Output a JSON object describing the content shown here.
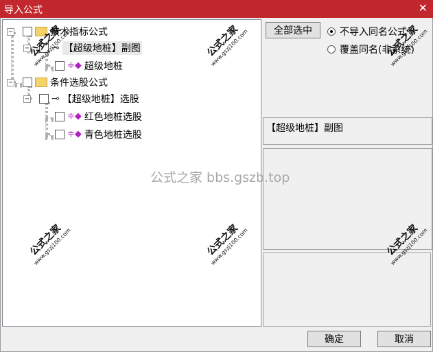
{
  "window": {
    "title": "导入公式",
    "close_glyph": "✕"
  },
  "tree": {
    "nodes": [
      {
        "id": "tech",
        "label": "技术指标公式",
        "kind": "folder"
      },
      {
        "id": "tech_sub",
        "label": "【超级地桩】副图",
        "kind": "key"
      },
      {
        "id": "tech_leaf",
        "label": "超级地桩",
        "kind": "formula"
      },
      {
        "id": "cond",
        "label": "条件选股公式",
        "kind": "folder"
      },
      {
        "id": "cond_sub",
        "label": "【超级地桩】选股",
        "kind": "key"
      },
      {
        "id": "cond_leaf1",
        "label": "红色地桩选股",
        "kind": "formula"
      },
      {
        "id": "cond_leaf2",
        "label": "青色地桩选股",
        "kind": "formula"
      }
    ],
    "expander_glyph": "−"
  },
  "right": {
    "select_all_label": "全部选中",
    "radio_options": [
      {
        "label": "不导入同名公式",
        "selected": true
      },
      {
        "label": "覆盖同名(非系统)",
        "selected": false
      }
    ],
    "info_text": "【超级地桩】副图"
  },
  "footer": {
    "ok_label": "确定",
    "cancel_label": "取消"
  },
  "watermark": {
    "main_text": "公式之家",
    "url_text": "www.gszj100.com",
    "center_text": "公式之家 bbs.gszb.top"
  }
}
